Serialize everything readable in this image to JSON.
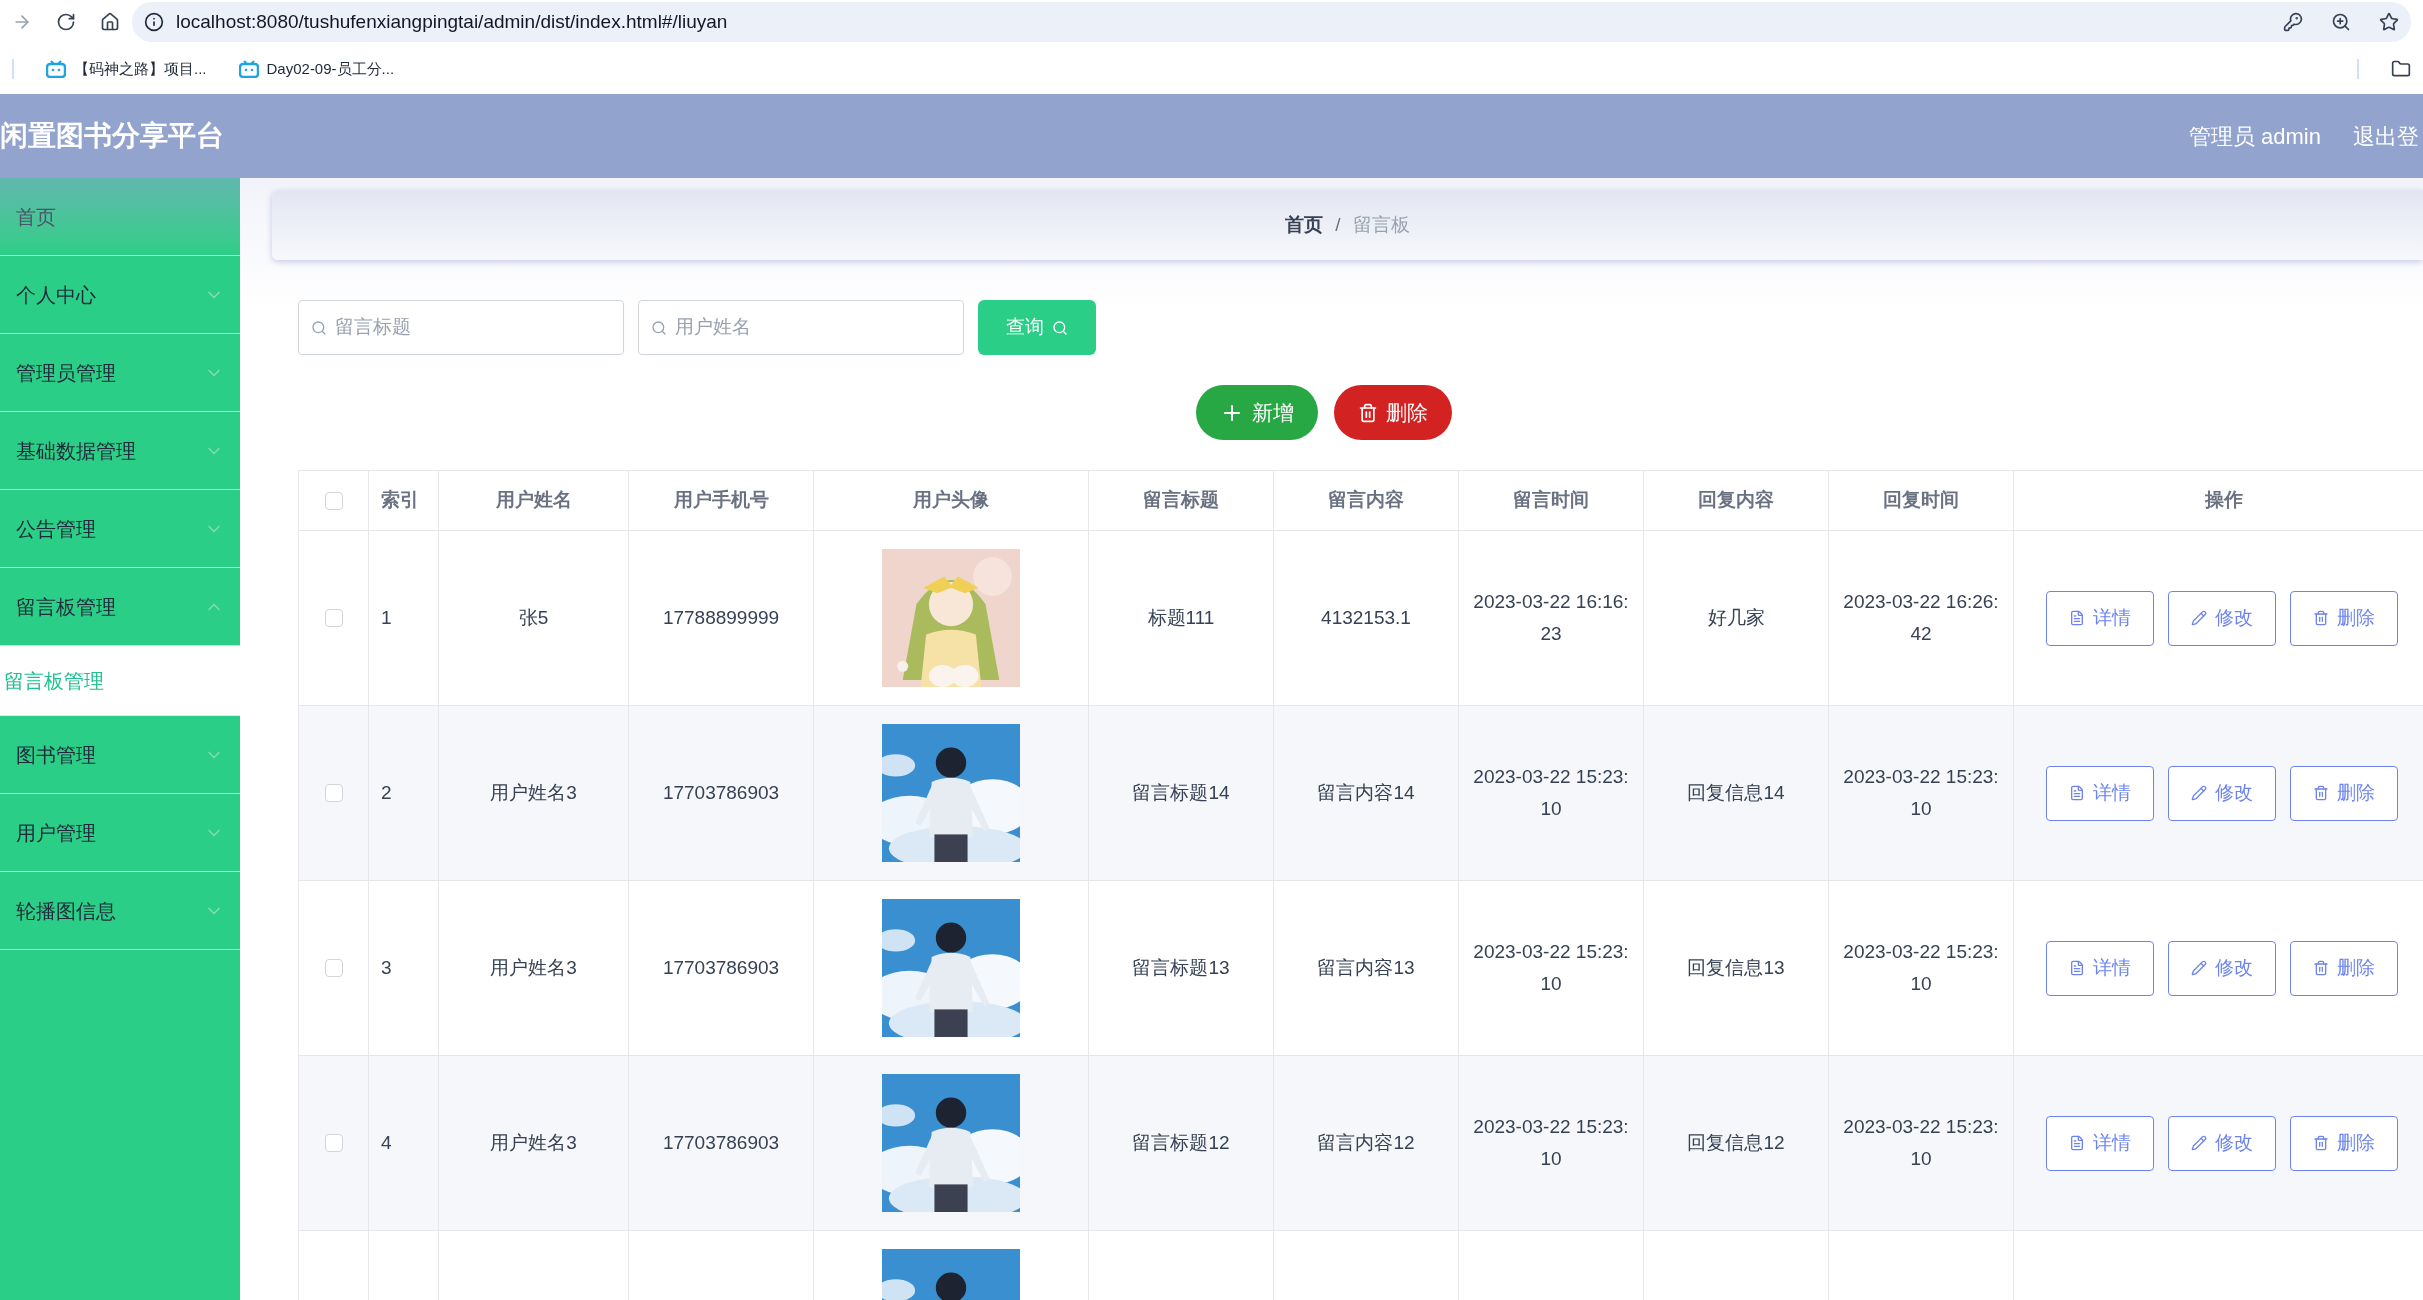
{
  "browser": {
    "url": "localhost:8080/tushufenxiangpingtai/admin/dist/index.html#/liuyan",
    "bookmarks": [
      "【码神之路】项目...",
      "Day02-09-员工分..."
    ]
  },
  "header": {
    "title": "闲置图书分享平台",
    "user": "管理员 admin",
    "logout": "退出登"
  },
  "sidebar": {
    "items": [
      {
        "label": "首页",
        "kind": "link"
      },
      {
        "label": "个人中心",
        "kind": "menu",
        "expanded": false
      },
      {
        "label": "管理员管理",
        "kind": "menu",
        "expanded": false
      },
      {
        "label": "基础数据管理",
        "kind": "menu",
        "expanded": false
      },
      {
        "label": "公告管理",
        "kind": "menu",
        "expanded": false
      },
      {
        "label": "留言板管理",
        "kind": "menu",
        "expanded": true,
        "children": [
          {
            "label": "留言板管理",
            "selected": true
          }
        ]
      },
      {
        "label": "图书管理",
        "kind": "menu",
        "expanded": false
      },
      {
        "label": "用户管理",
        "kind": "menu",
        "expanded": false
      },
      {
        "label": "轮播图信息",
        "kind": "menu",
        "expanded": false
      }
    ]
  },
  "breadcrumb": {
    "separator": "/",
    "items": [
      {
        "label": "首页",
        "current": false
      },
      {
        "label": "留言板",
        "current": true
      }
    ]
  },
  "search": {
    "fields": [
      {
        "placeholder": "留言标题"
      },
      {
        "placeholder": "用户姓名"
      }
    ],
    "button": "查询"
  },
  "actions": {
    "add": "新增",
    "delete": "删除"
  },
  "table": {
    "all_checked": false,
    "columns": [
      "索引",
      "用户姓名",
      "用户手机号",
      "用户头像",
      "留言标题",
      "留言内容",
      "留言时间",
      "回复内容",
      "回复时间",
      "操作"
    ],
    "rows": [
      {
        "checked": false,
        "cells": [
          "1",
          "张5",
          "17788899999",
          null,
          "标题111",
          "4132153.1",
          "2023-03-22 16:16:23",
          "好几家",
          "2023-03-22 16:26:42"
        ],
        "avatar": {
          "kind": "picture"
        },
        "buttons": [
          "详情",
          "修改",
          "删除"
        ]
      },
      {
        "checked": false,
        "cells": [
          "2",
          "用户姓名3",
          "17703786903",
          null,
          "留言标题14",
          "留言内容14",
          "2023-03-22 15:23:10",
          "回复信息14",
          "2023-03-22 15:23:10"
        ],
        "avatar": {
          "kind": "picture"
        },
        "buttons": [
          "详情",
          "修改",
          "删除"
        ]
      },
      {
        "checked": false,
        "cells": [
          "3",
          "用户姓名3",
          "17703786903",
          null,
          "留言标题13",
          "留言内容13",
          "2023-03-22 15:23:10",
          "回复信息13",
          "2023-03-22 15:23:10"
        ],
        "avatar": {
          "kind": "picture"
        },
        "buttons": [
          "详情",
          "修改",
          "删除"
        ]
      },
      {
        "checked": false,
        "cells": [
          "4",
          "用户姓名3",
          "17703786903",
          null,
          "留言标题12",
          "留言内容12",
          "2023-03-22 15:23:10",
          "回复信息12",
          "2023-03-22 15:23:10"
        ],
        "avatar": {
          "kind": "picture"
        },
        "buttons": [
          "详情",
          "修改",
          "删除"
        ]
      },
      {
        "avatar": {
          "kind": "picture"
        }
      }
    ]
  }
}
